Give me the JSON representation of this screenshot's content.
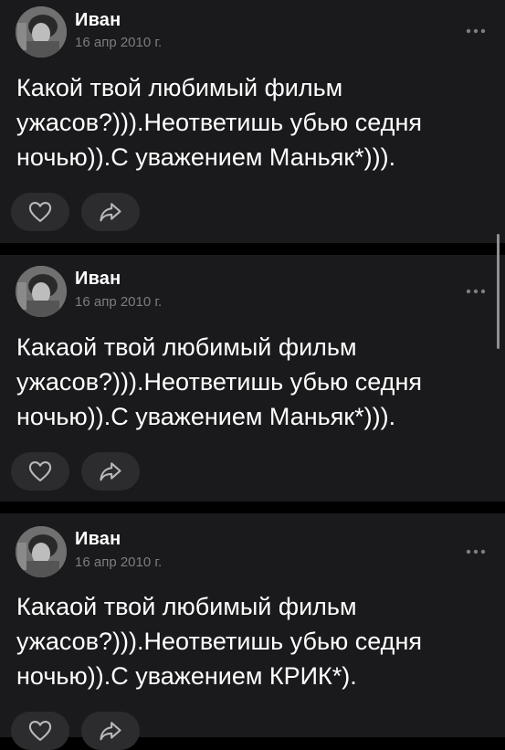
{
  "posts": [
    {
      "author": "Иван",
      "date": "16 апр 2010 г.",
      "text": "Какой твой любимый фильм ужасов?))).Неответишь убью седня ночью)).С уважением Маньяк*)))."
    },
    {
      "author": "Иван",
      "date": "16 апр 2010 г.",
      "text": "Какаой твой любимый фильм ужасов?))).Неответишь убью седня ночью)).С уважением Маньяк*)))."
    },
    {
      "author": "Иван",
      "date": "16 апр 2010 г.",
      "text": "Какаой твой любимый фильм ужасов?))).Неответишь убью седня ночью)).С уважением КРИК*)."
    }
  ],
  "icons": {
    "like": "heart-icon",
    "share": "share-arrow-icon",
    "more": "more-dots-icon"
  },
  "colors": {
    "background": "#000000",
    "card": "#1a1a1c",
    "button": "#2c2c2e",
    "text": "#ffffff",
    "secondary_text": "#7d7d82"
  }
}
